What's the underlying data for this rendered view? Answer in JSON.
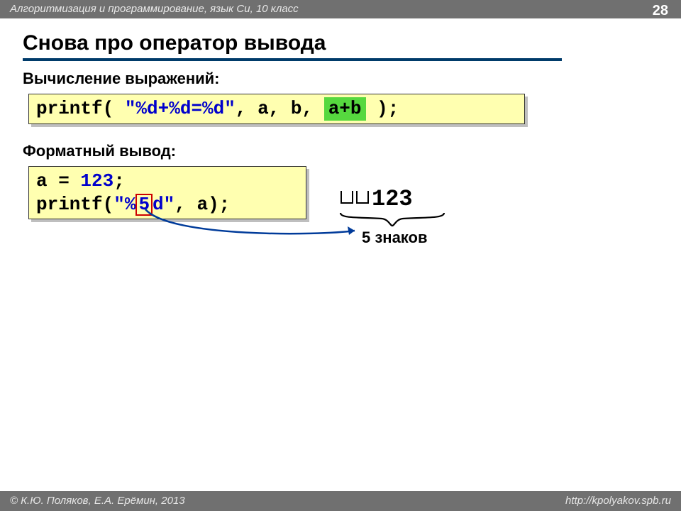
{
  "header": {
    "course": "Алгоритмизация и программирование, язык Си, 10 класс",
    "page": "28"
  },
  "title": "Снова про оператор вывода",
  "sections": {
    "s1": "Вычисление выражений:",
    "s2": "Форматный вывод:"
  },
  "code1": {
    "p1": "printf( ",
    "fmt": "\"%d+%d=%d\"",
    "p2": ", a, b, ",
    "hi": "a+b",
    "p3": " );"
  },
  "code2": {
    "l1a": "a = ",
    "l1num": "123",
    "l1b": ";",
    "l2a": "printf(",
    "l2fmt1": "\"%",
    "l2hi": "5",
    "l2fmt2": "d\"",
    "l2b": ", a);"
  },
  "output": "123",
  "caption": "5 знаков",
  "footer": {
    "left": "© К.Ю. Поляков, Е.А. Ерёмин, 2013",
    "right": "http://kpolyakov.spb.ru"
  }
}
